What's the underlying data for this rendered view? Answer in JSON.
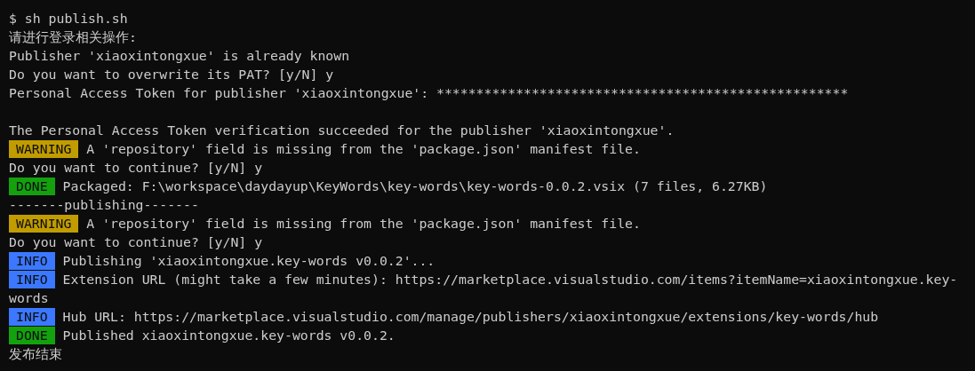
{
  "terminal": {
    "lines": [
      {
        "kind": "command",
        "prompt": "$",
        "text": "sh publish.sh"
      },
      {
        "kind": "output",
        "text": "请进行登录相关操作:"
      },
      {
        "kind": "output",
        "text": "Publisher 'xiaoxintongxue' is already known"
      },
      {
        "kind": "output",
        "text": "Do you want to overwrite its PAT? [y/N] y"
      },
      {
        "kind": "output",
        "text": "Personal Access Token for publisher 'xiaoxintongxue': ****************************************************"
      },
      {
        "kind": "blank"
      },
      {
        "kind": "output",
        "text": "The Personal Access Token verification succeeded for the publisher 'xiaoxintongxue'."
      },
      {
        "kind": "tagged",
        "tag": {
          "label": "WARNING",
          "kind": "warning"
        },
        "text": "A 'repository' field is missing from the 'package.json' manifest file."
      },
      {
        "kind": "output",
        "text": "Do you want to continue? [y/N] y"
      },
      {
        "kind": "tagged",
        "tag": {
          "label": "DONE",
          "kind": "done"
        },
        "text": "Packaged: F:\\workspace\\daydayup\\KeyWords\\key-words\\key-words-0.0.2.vsix (7 files, 6.27KB)"
      },
      {
        "kind": "output",
        "text": "-------publishing-------"
      },
      {
        "kind": "tagged",
        "tag": {
          "label": "WARNING",
          "kind": "warning"
        },
        "text": "A 'repository' field is missing from the 'package.json' manifest file."
      },
      {
        "kind": "output",
        "text": "Do you want to continue? [y/N] y"
      },
      {
        "kind": "tagged",
        "tag": {
          "label": "INFO",
          "kind": "info"
        },
        "text": "Publishing 'xiaoxintongxue.key-words v0.0.2'..."
      },
      {
        "kind": "tagged",
        "tag": {
          "label": "INFO",
          "kind": "info"
        },
        "text": "Extension URL (might take a few minutes): https://marketplace.visualstudio.com/items?itemName=xiaoxintongxue.key-"
      },
      {
        "kind": "output",
        "text": "words"
      },
      {
        "kind": "tagged",
        "tag": {
          "label": "INFO",
          "kind": "info"
        },
        "text": "Hub URL: https://marketplace.visualstudio.com/manage/publishers/xiaoxintongxue/extensions/key-words/hub"
      },
      {
        "kind": "tagged",
        "tag": {
          "label": "DONE",
          "kind": "done"
        },
        "text": "Published xiaoxintongxue.key-words v0.0.2."
      },
      {
        "kind": "output",
        "text": "发布结束"
      }
    ]
  }
}
